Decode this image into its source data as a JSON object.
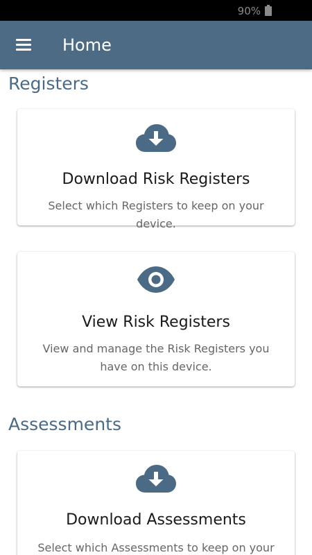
{
  "status_bar": {
    "battery_text": "90%"
  },
  "app_bar": {
    "title": "Home",
    "menu_icon": "hamburger-menu-icon"
  },
  "sections": {
    "registers": {
      "title": "Registers",
      "cards": [
        {
          "icon": "cloud-download-icon",
          "title": "Download Risk Registers",
          "description": "Select which Registers to keep on your device."
        },
        {
          "icon": "eye-icon",
          "title": "View Risk Registers",
          "description": "View and manage the Risk Registers you have on this device."
        }
      ]
    },
    "assessments": {
      "title": "Assessments",
      "cards": [
        {
          "icon": "cloud-download-icon",
          "title": "Download Assessments",
          "description": "Select which Assessments to keep on your"
        }
      ]
    }
  },
  "colors": {
    "primary": "#4e6b85",
    "section_title": "#4a6a85",
    "icon": "#4a6a85",
    "card_title": "#1a1a1a",
    "card_description": "#666666"
  }
}
